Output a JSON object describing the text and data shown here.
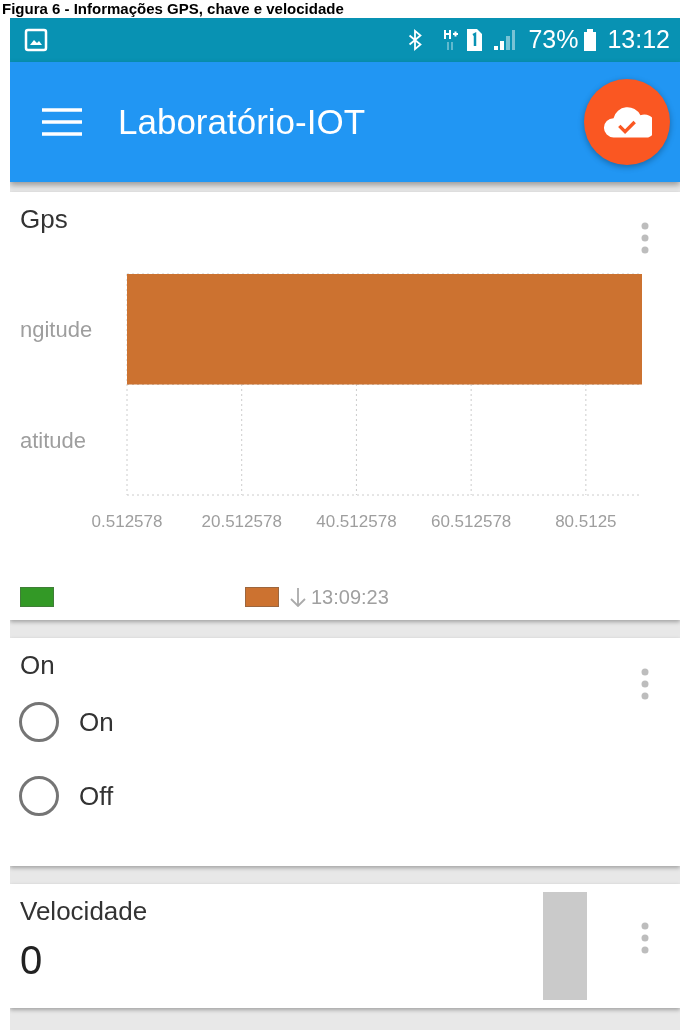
{
  "caption": "Figura 6 - Informações GPS, chave e velocidade",
  "status_bar": {
    "battery_text": "73%",
    "time": "13:12"
  },
  "app_bar": {
    "title": "Laboratório-IOT"
  },
  "cards": [
    {
      "kind": "chart",
      "title": "Gps",
      "chart_data": {
        "type": "bar",
        "orientation": "horizontal",
        "categories": [
          "ngitude",
          "atitude"
        ],
        "series": [
          {
            "color": "#339926",
            "values": [
              null,
              null
            ]
          },
          {
            "name": "13:09:23",
            "color": "#cc7230",
            "values": [
              90.3,
              null
            ]
          }
        ],
        "xlim": [
          0.512578,
          90.3
        ],
        "grid": true,
        "xticks": [
          {
            "value": 0.512578,
            "label": "0.512578"
          },
          {
            "value": 20.512578,
            "label": "20.512578"
          },
          {
            "value": 40.512578,
            "label": "40.512578"
          },
          {
            "value": 60.512578,
            "label": "60.512578"
          },
          {
            "value": 80.5125,
            "label": "80.5125"
          }
        ]
      }
    },
    {
      "kind": "radio",
      "title": "On",
      "options": [
        {
          "label": "On",
          "selected": false
        },
        {
          "label": "Off",
          "selected": false
        }
      ]
    },
    {
      "kind": "gauge",
      "title": "Velocidade",
      "value": "0"
    }
  ]
}
